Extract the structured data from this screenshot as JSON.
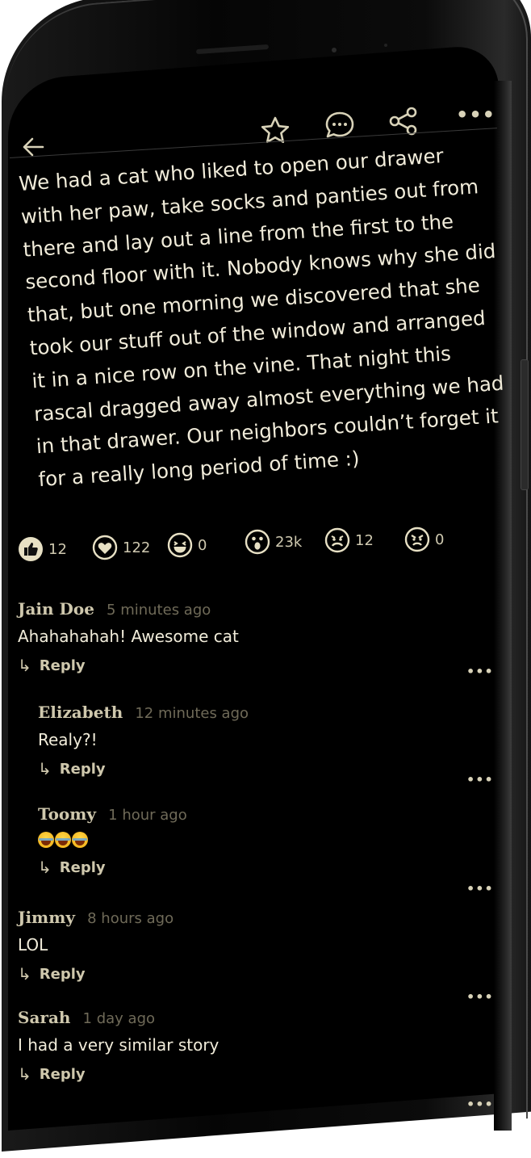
{
  "toolbar": {
    "back_icon": "arrow-left-icon",
    "favorite_icon": "star-icon",
    "comment_icon": "chat-bubble-icon",
    "share_icon": "share-icon",
    "more_icon": "more-horizontal-icon",
    "more_label": "•••"
  },
  "post": {
    "lines": [
      "We had a cat who liked to open our drawer",
      "with her paw, take socks and panties out from",
      "there and lay out a line from the first to the",
      "second floor with it. Nobody knows why she did",
      "that, but one morning we discovered that she",
      "took our stuff out of the window and arranged",
      "it in a nice row on the vine. That night this",
      "rascal dragged away almost everything we had",
      "in that drawer. Our neighbors couldn’t forget it",
      "for a really long period of time :)"
    ]
  },
  "reactions": [
    {
      "icon": "thumbs-up-icon",
      "count": "12"
    },
    {
      "icon": "heart-icon",
      "count": "122"
    },
    {
      "icon": "laughing-face-icon",
      "count": "0"
    },
    {
      "icon": "surprised-face-icon",
      "count": "23k"
    },
    {
      "icon": "sad-face-icon",
      "count": "12"
    },
    {
      "icon": "angry-face-icon",
      "count": "0"
    }
  ],
  "comments": [
    {
      "name": "Jain Doe",
      "time": "5 minutes ago",
      "text": "Ahahahahah! Awesome cat",
      "reply": "Reply"
    },
    {
      "name": "Elizabeth",
      "time": "12 minutes ago",
      "text": "Realy?!",
      "reply": "Reply"
    },
    {
      "name": "Toomy",
      "time": "1 hour ago",
      "text": "😂😂😂",
      "reply": "Reply"
    },
    {
      "name": "Jimmy",
      "time": "8 hours ago",
      "text": "LOL",
      "reply": "Reply"
    },
    {
      "name": "Sarah",
      "time": "1 day ago",
      "text": "I had a very similar story",
      "reply": "Reply"
    }
  ],
  "colors": {
    "background": "#000000",
    "text": "#f1ecda",
    "accent": "#cfc8ad",
    "muted": "#6f6a58"
  }
}
